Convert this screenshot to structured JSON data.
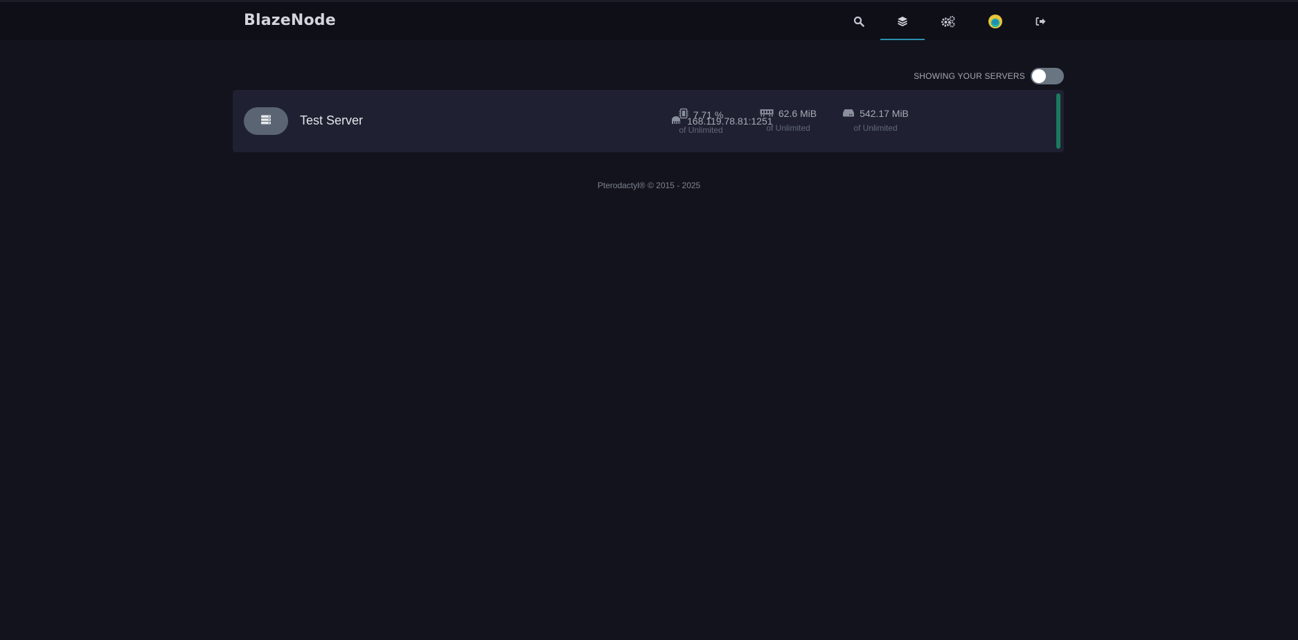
{
  "brand": {
    "name": "BlazeNode"
  },
  "nav": {
    "items": [
      {
        "icon": "search-icon",
        "active": false
      },
      {
        "icon": "layers-icon",
        "active": true
      },
      {
        "icon": "cogs-icon",
        "active": false
      },
      {
        "icon": "avatar",
        "active": false
      },
      {
        "icon": "sign-out-icon",
        "active": false
      }
    ]
  },
  "filter": {
    "label": "Showing your servers",
    "toggle_on": false
  },
  "servers": [
    {
      "name": "Test Server",
      "address": "168.119.78.81:1251",
      "cpu": {
        "value": "7.71 %",
        "limit": "of Unlimited"
      },
      "memory": {
        "value": "62.6 MiB",
        "limit": "of Unlimited"
      },
      "disk": {
        "value": "542.17 MiB",
        "limit": "of Unlimited"
      },
      "status_color": "#1c7a5c"
    }
  ],
  "footer": {
    "text": "Pterodactyl® © 2015 - 2025"
  },
  "colors": {
    "background": "#12131c",
    "navbar": "#0e0f17",
    "card": "#1f2132",
    "accent": "#2c8fb0",
    "status_running": "#1c7a5c"
  }
}
